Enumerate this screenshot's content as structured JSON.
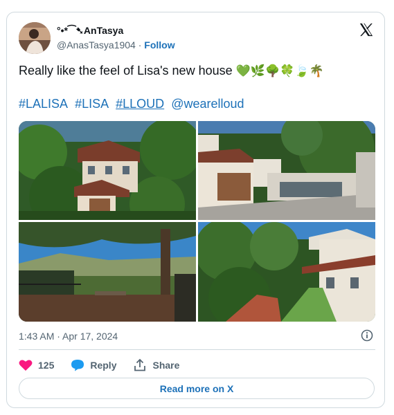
{
  "author": {
    "display_name": "°•*⁀➷AnTasya",
    "handle": "@AnasTasya1904",
    "separator": "·",
    "follow_label": "Follow"
  },
  "tweet": {
    "text": "Really like the feel of Lisa's new house",
    "emojis": "💚🌿🌳🍀🍃🌴",
    "hashtags": [
      "#LALISA",
      "#LISA",
      "#LLOUD"
    ],
    "mention": "@wearelloud"
  },
  "meta": {
    "timestamp": "1:43 AM · Apr 17, 2024"
  },
  "actions": {
    "like_count": "125",
    "reply_label": "Reply",
    "share_label": "Share"
  },
  "footer": {
    "read_more_label": "Read more on X"
  },
  "colors": {
    "link": "#1d71b8",
    "like": "#f91880",
    "reply": "#1d9bf0",
    "text": "#0f1419",
    "muted": "#536471",
    "border": "#cfd9de"
  },
  "icons": {
    "logo": "x-logo-icon",
    "info": "info-icon",
    "like": "heart-icon",
    "reply": "speech-bubble-icon",
    "share": "share-upload-icon"
  }
}
